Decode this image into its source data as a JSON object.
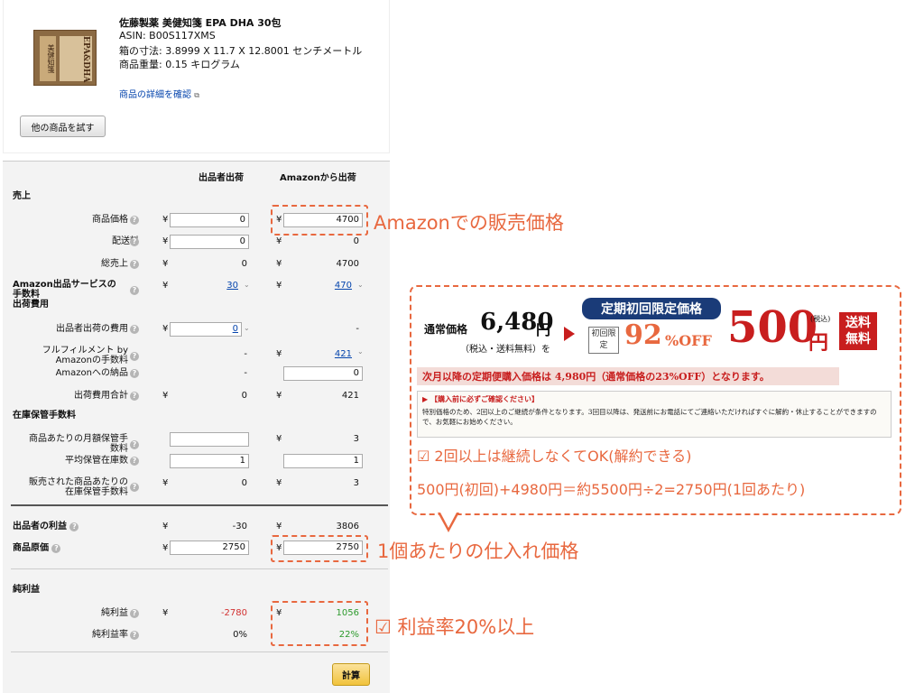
{
  "product": {
    "title": "佐藤製薬 美健知箋 EPA DHA 30包",
    "asin": "ASIN: B00S117XMS",
    "dimensions": "箱の寸法: 3.8999 X 11.7 X 12.8001 センチメートル",
    "weight": "商品重量: 0.15 キログラム",
    "detail_link": "商品の詳細を確認",
    "try_other_button": "他の商品を試す",
    "thumb_text_a": "美健知箋",
    "thumb_text_b": "EPA&DHA"
  },
  "calculator": {
    "col_seller": "出品者出荷",
    "col_amazon": "Amazonから出荷",
    "section_sales": "売上",
    "item_price_label": "商品価格",
    "item_price_seller": "0",
    "item_price_amazon": "4700",
    "shipping_label": "配送料",
    "shipping_seller": "0",
    "shipping_amazon": "0",
    "total_sales_label": "総売上",
    "total_sales_seller": "0",
    "total_sales_amazon": "4700",
    "section_fees_line1": "Amazon出品サービスの",
    "section_fees_line2": "手数料",
    "section_ship_cost": "出荷費用",
    "fees_seller": "30",
    "fees_amazon": "470",
    "seller_ship_label": "出品者出荷の費用",
    "seller_ship_seller": "0",
    "seller_ship_amazon": "-",
    "fba_fee_line1": "フルフィルメント by",
    "fba_fee_line2": "Amazonの手数料",
    "fba_fee_seller": "-",
    "fba_fee_amazon": "421",
    "inbound_label": "Amazonへの納品",
    "inbound_seller": "-",
    "inbound_amazon": "0",
    "ship_total_label": "出荷費用合計",
    "ship_total_seller": "0",
    "ship_total_amazon": "421",
    "section_storage": "在庫保管手数料",
    "monthly_storage_line1": "商品あたりの月額保管手",
    "monthly_storage_line2": "数料",
    "monthly_storage_seller": "",
    "monthly_storage_amazon": "3",
    "avg_inventory_label": "平均保管在庫数",
    "avg_inventory_seller": "1",
    "avg_inventory_amazon": "1",
    "sold_storage_line1": "販売された商品あたりの",
    "sold_storage_line2": "在庫保管手数料",
    "sold_storage_seller": "0",
    "sold_storage_amazon": "3",
    "seller_profit_label": "出品者の利益",
    "seller_profit_seller": "-30",
    "seller_profit_amazon": "3806",
    "cost_label": "商品原価",
    "cost_seller": "2750",
    "cost_amazon": "2750",
    "section_net": "純利益",
    "net_profit_label": "純利益",
    "net_profit_seller": "-2780",
    "net_profit_amazon": "1056",
    "net_margin_label": "純利益率",
    "net_margin_seller": "0%",
    "net_margin_amazon": "22%",
    "calc_button": "計算",
    "yen": "¥",
    "q": "?"
  },
  "annotations": {
    "sale_price": "Amazonでの販売価格",
    "purchase_price": "1個あたりの仕入れ価格",
    "margin": "☑ 利益率20%以上",
    "cancel_ok": "☑ 2回以上は継続しなくてOK(解約できる)",
    "calc_note": "500円(初回)+4980円＝約5500円÷2=2750円(1回あたり)"
  },
  "banner": {
    "regular_label": "通常価格",
    "regular_price": "6,480",
    "yen_unit": "円",
    "tax_note": "（税込・送料無料）を",
    "campaign_title": "定期初回限定価格",
    "first_time": "初回限定",
    "discount": "92",
    "percent_off": "%OFF",
    "price": "500",
    "tax_inc": "(税込)",
    "free_ship": "送料無料",
    "next_month": "次月以降の定期便購入価格は 4,980円（通常価格の23%OFF）となります。",
    "must_read_title": "【購入前に必ずご確認ください】",
    "must_read_body": "特別価格のため、2回以上のご継続が条件となります。3回目以降は、発送前にお電話にてご連絡いただければすぐに解約・休止することができますので、お気軽にお始めください。"
  },
  "colors": {
    "accent_orange": "#e8683f",
    "banner_red": "#c81e1e",
    "navy": "#1a3b78",
    "profit_green": "#2c9a2c",
    "loss_red": "#d23030",
    "link_blue": "#0645ad"
  }
}
